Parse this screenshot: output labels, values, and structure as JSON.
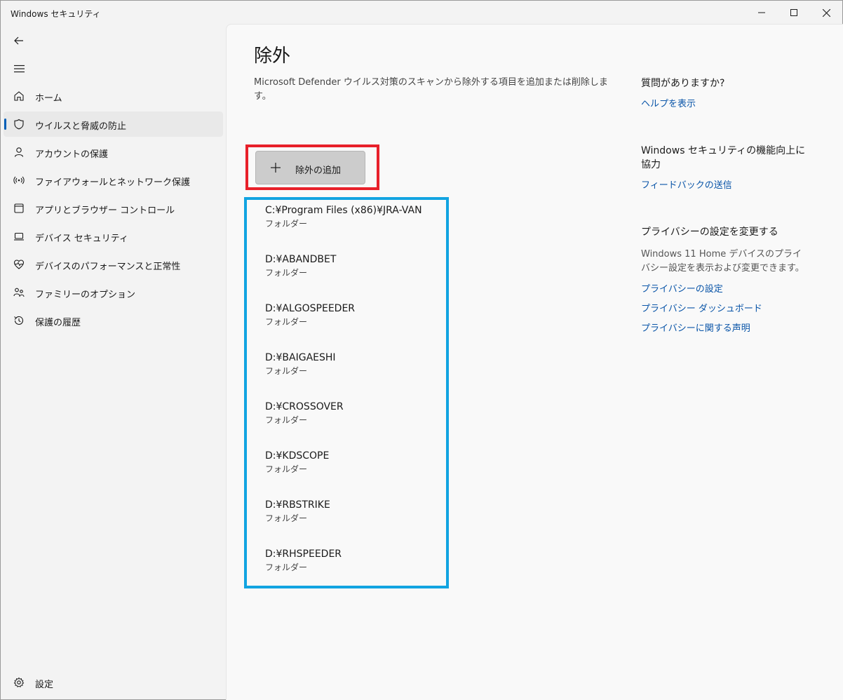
{
  "window": {
    "title": "Windows セキュリティ"
  },
  "sidebar": {
    "items": [
      {
        "label": "ホーム",
        "icon": "home-icon"
      },
      {
        "label": "ウイルスと脅威の防止",
        "icon": "shield-icon",
        "active": true
      },
      {
        "label": "アカウントの保護",
        "icon": "person-icon"
      },
      {
        "label": "ファイアウォールとネットワーク保護",
        "icon": "wireless-icon"
      },
      {
        "label": "アプリとブラウザー コントロール",
        "icon": "app-window-icon"
      },
      {
        "label": "デバイス セキュリティ",
        "icon": "laptop-icon"
      },
      {
        "label": "デバイスのパフォーマンスと正常性",
        "icon": "heart-pulse-icon"
      },
      {
        "label": "ファミリーのオプション",
        "icon": "family-icon"
      },
      {
        "label": "保護の履歴",
        "icon": "history-icon"
      }
    ],
    "settings_label": "設定"
  },
  "main": {
    "title": "除外",
    "description": "Microsoft Defender ウイルス対策のスキャンから除外する項目を追加または削除します。",
    "add_button_label": "除外の追加",
    "exclusions": [
      {
        "path": "C:¥Program Files (x86)¥JRA-VAN",
        "type": "フォルダー"
      },
      {
        "path": "D:¥ABANDBET",
        "type": "フォルダー"
      },
      {
        "path": "D:¥ALGOSPEEDER",
        "type": "フォルダー"
      },
      {
        "path": "D:¥BAIGAESHI",
        "type": "フォルダー"
      },
      {
        "path": "D:¥CROSSOVER",
        "type": "フォルダー"
      },
      {
        "path": "D:¥KDSCOPE",
        "type": "フォルダー"
      },
      {
        "path": "D:¥RBSTRIKE",
        "type": "フォルダー"
      },
      {
        "path": "D:¥RHSPEEDER",
        "type": "フォルダー"
      }
    ]
  },
  "side": {
    "question_heading": "質問がありますか?",
    "help_link": "ヘルプを表示",
    "feedback_heading": "Windows セキュリティの機能向上に協力",
    "feedback_link": "フィードバックの送信",
    "privacy_heading": "プライバシーの設定を変更する",
    "privacy_text": "Windows 11 Home デバイスのプライバシー設定を表示および変更できます。",
    "privacy_links": [
      "プライバシーの設定",
      "プライバシー ダッシュボード",
      "プライバシーに関する声明"
    ]
  },
  "colors": {
    "accent": "#005fb8",
    "link": "#0a55a8",
    "highlight_red": "#e8202a",
    "highlight_blue": "#12a4e1"
  }
}
